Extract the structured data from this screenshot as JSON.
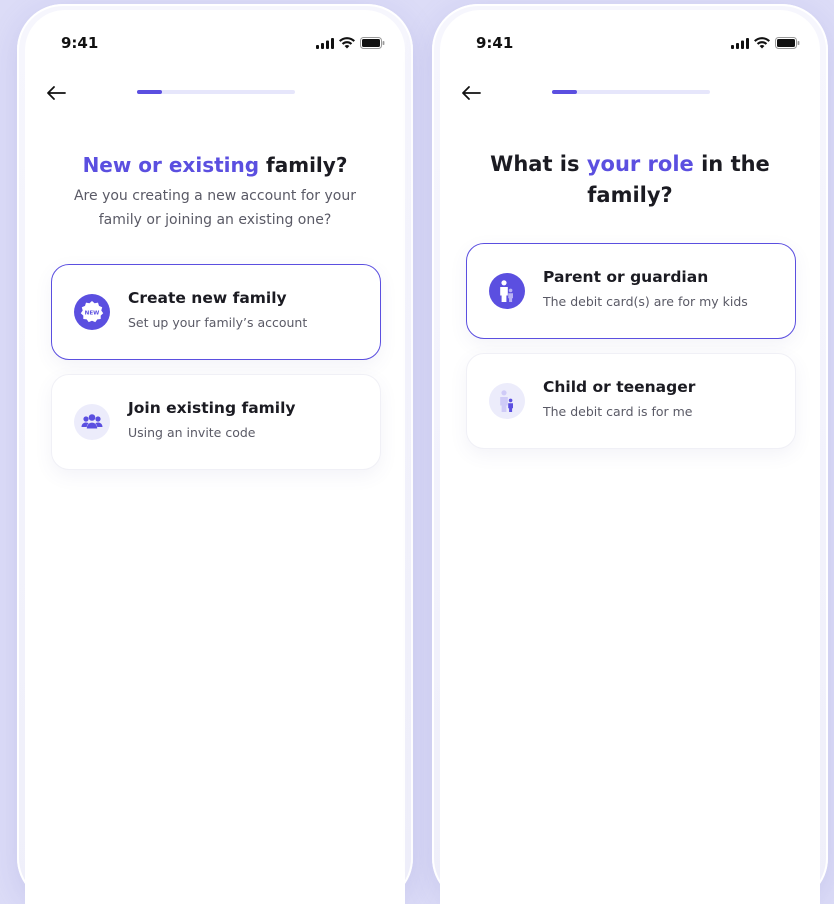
{
  "colors": {
    "accent": "#5b4fe0",
    "background": "#dcdcf7",
    "icon_bg_light": "#ececfb"
  },
  "screen_left": {
    "status_time": "9:41",
    "progress": 0.16,
    "title_accent": "New or existing",
    "title_rest": " family?",
    "subtitle": "Are you creating a new account for your family or joining an existing one?",
    "options": [
      {
        "icon": "new-badge-icon",
        "title": "Create new family",
        "description": "Set up your family’s account",
        "selected": true
      },
      {
        "icon": "group-icon",
        "title": "Join existing family",
        "description": "Using an invite code",
        "selected": false
      }
    ]
  },
  "screen_right": {
    "status_time": "9:41",
    "progress": 0.16,
    "title_pre": "What is ",
    "title_accent": "your role",
    "title_post": " in the family?",
    "options": [
      {
        "icon": "parent-icon",
        "title": "Parent or guardian",
        "description": "The debit card(s) are for my kids",
        "selected": true
      },
      {
        "icon": "child-icon",
        "title": "Child or teenager",
        "description": "The debit card is for me",
        "selected": false
      }
    ]
  },
  "icon_labels": {
    "new_badge_text": "NEW"
  }
}
